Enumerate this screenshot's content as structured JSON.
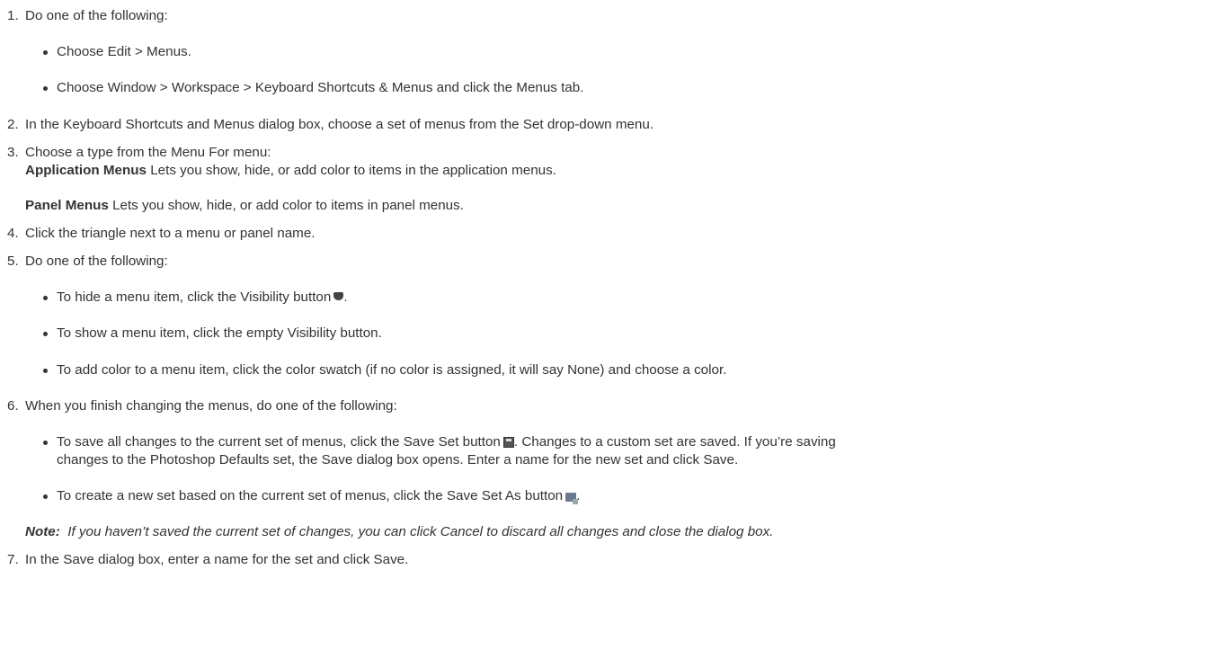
{
  "steps": [
    {
      "num": "1.",
      "text": "Do one of the following:"
    },
    {
      "num": "2.",
      "text": "In the Keyboard Shortcuts and Menus dialog box, choose a set of menus from the Set drop-down menu."
    },
    {
      "num": "3.",
      "text": "Choose a type from the Menu For menu:"
    },
    {
      "num": "4.",
      "text": "Click the triangle next to a menu or panel name."
    },
    {
      "num": "5.",
      "text": "Do one of the following:"
    },
    {
      "num": "6.",
      "text": "When you finish changing the menus, do one of the following:"
    },
    {
      "num": "7.",
      "text": "In the Save dialog box, enter a name for the set and click Save."
    }
  ],
  "step1_bullets": [
    "Choose Edit > Menus.",
    "Choose Window > Workspace > Keyboard Shortcuts & Menus and click the Menus tab."
  ],
  "step3_items": [
    {
      "term": "Application Menus",
      "desc": " Lets you show, hide, or add color to items in the application menus."
    },
    {
      "term": "Panel Menus",
      "desc": " Lets you show, hide, or add color to items in panel menus."
    }
  ],
  "step5_bullets": [
    "To hide a menu item, click the Visibility button",
    "To show a menu item, click the empty Visibility button.",
    "To add color to a menu item, click the color swatch (if no color is assigned, it will say None) and choose a color."
  ],
  "step5_bullet1_end": ".",
  "step6_bullets": {
    "b1_line1": "To save all changes to the current set of menus, click the Save Set button",
    "b1_line1_after": ". Changes to a custom set are saved. If you’re saving",
    "b1_line2": "changes to the Photoshop Defaults set, the Save dialog box opens. Enter a name for the new set and click Save.",
    "b2": "To create a new set based on the current set of menus, click the Save Set As button",
    "b2_end": "."
  },
  "note": {
    "label": "Note:",
    "text": "  If you haven’t saved the current set of changes, you can click Cancel to discard all changes and close the dialog box."
  },
  "icons": {
    "visibility": "visibility-eye-icon",
    "save_set": "save-set-icon",
    "save_set_as": "save-set-as-icon"
  }
}
